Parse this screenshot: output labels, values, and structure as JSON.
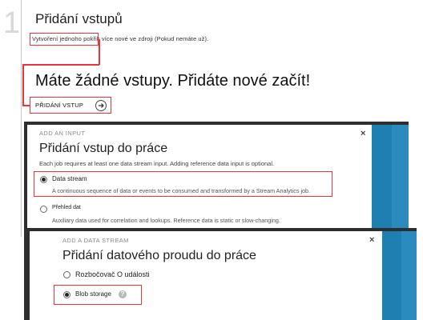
{
  "step": {
    "number": "1"
  },
  "section": {
    "title": "Přidání vstupů",
    "desc_link": "Vytvoření jednoho pokřik",
    "desc_rest": " více nové ve zdroji (Pokud nemáte už)."
  },
  "empty_state": {
    "title": "Máte žádné vstupy. Přidáte nové začít!",
    "add_button_label": "PŘIDÁNÍ VSTUP"
  },
  "add_input_dialog": {
    "label": "ADD AN INPUT",
    "close": "×",
    "title": "Přidání vstup do práce",
    "subtitle": "Each job requires at least one data stream input. Adding reference data input is optional.",
    "options": [
      {
        "name": "Data stream",
        "desc": "A continuous sequence of data or events to be consumed and transformed by a Stream Analytics job.",
        "selected": true
      },
      {
        "name": "Přehled dat",
        "desc": "Auxiliary data used for correlation and lookups. Reference data is static or slow-changing.",
        "selected": false
      }
    ]
  },
  "add_stream_dialog": {
    "label": "ADD A DATA STREAM",
    "close": "×",
    "title": "Přidání datového proudu do práce",
    "options": [
      {
        "name": "Rozbočovač O události",
        "selected": false
      },
      {
        "name": "Blob storage",
        "selected": true,
        "help": "?"
      }
    ]
  },
  "colors": {
    "highlight": "#e8343c",
    "blue_strip": "#1f7fb0",
    "dialog_frame": "#2e2e2e"
  },
  "icons": [
    "arrow-right-circle-icon",
    "close-icon",
    "help-icon",
    "radio-icon"
  ]
}
